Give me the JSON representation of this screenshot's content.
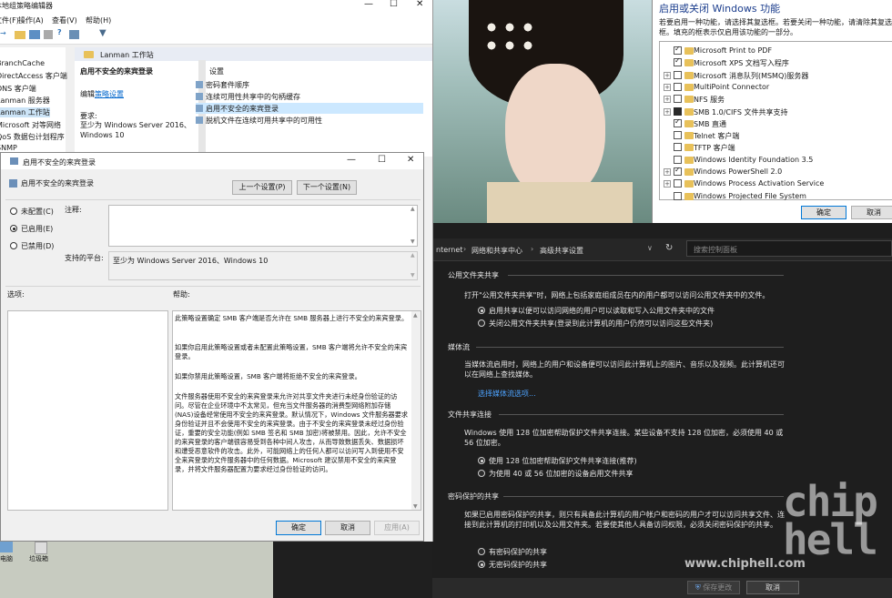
{
  "photo": {
    "alt": ""
  },
  "gpedit": {
    "title": "本地组策略编辑器",
    "menu": [
      "文件(F)",
      "操作(A)",
      "查看(V)",
      "帮助(H)"
    ],
    "tree": [
      "BranchCache",
      "DirectAccess 客户端",
      "DNS 客户端",
      "Lanman 服务器",
      "Lanman 工作站",
      "Microsoft 对等网络",
      "QoS 数据包计划程序",
      "SNMP"
    ],
    "tab_label": "Lanman 工作站",
    "policy_title": "启用不安全的来宾登录",
    "edit_prefix": "编辑",
    "edit_link": "策略设置",
    "req_label": "要求:",
    "req_text": "至少为 Windows Server 2016、Windows 10",
    "settings_header": "设置",
    "settings": [
      "密码套件顺序",
      "连续可用性共享中的句柄缓存",
      "启用不安全的来宾登录",
      "脱机文件在连续可用共享中的可用性"
    ],
    "taskbar_icons": [
      "电脑",
      "垃圾箱"
    ]
  },
  "dialog": {
    "title": "启用不安全的来宾登录",
    "policy_name": "启用不安全的来宾登录",
    "prev_button": "上一个设置(P)",
    "next_button": "下一个设置(N)",
    "radio_not_configured": "未配置(C)",
    "radio_enabled": "已启用(E)",
    "radio_disabled": "已禁用(D)",
    "comment_label": "注释:",
    "platform_label": "支持的平台:",
    "platform_text": "至少为 Windows Server 2016、Windows 10",
    "options_label": "选项:",
    "help_label": "帮助:",
    "help_p1": "此策略设置确定 SMB 客户端是否允许在 SMB 服务器上进行不安全的来宾登录。",
    "help_p2": "如果你启用此策略设置或者未配置此策略设置，SMB 客户端将允许不安全的来宾登录。",
    "help_p3": "如果你禁用此策略设置，SMB 客户端将拒绝不安全的来宾登录。",
    "help_p4": "文件服务器使用不安全的来宾登录来允许对共享文件夹进行未经身份验证的访问。尽管在企业环境中不太常见，但充当文件服务器的消费型网络附加存储(NAS)设备经常使用不安全的来宾登录。默认情况下，Windows 文件服务器要求身份验证并且不会使用不安全的来宾登录。由于不安全的来宾登录未经过身份验证，重要的安全功能(例如 SMB 签名和 SMB 加密)将被禁用。因此，允许不安全的来宾登录的客户端很容易受到各种中间人攻击，从而导致数据丢失、数据损坏和遭受恶意软件的攻击。此外，可能网络上的任何人都可以访问写入到使用不安全来宾登录的文件服务器中的任何数据。Microsoft 建议禁用不安全的来宾登录，并将文件服务器配置为要求经过身份验证的访问。",
    "ok": "确定",
    "cancel": "取消",
    "apply": "应用(A)"
  },
  "features": {
    "title": "启用或关闭 Windows 功能",
    "desc": "若要启用一种功能，请选择其复选框。若要关闭一种功能，请清除其复选框。填充的框表示仅启用该功能的一部分。",
    "items": [
      {
        "label": "Microsoft Print to PDF",
        "state": "checked",
        "expand": false
      },
      {
        "label": "Microsoft XPS 文档写入程序",
        "state": "checked",
        "expand": false
      },
      {
        "label": "Microsoft 消息队列(MSMQ)服务器",
        "state": "empty",
        "expand": true
      },
      {
        "label": "MultiPoint Connector",
        "state": "empty",
        "expand": true
      },
      {
        "label": "NFS 服务",
        "state": "empty",
        "expand": true
      },
      {
        "label": "SMB 1.0/CIFS 文件共享支持",
        "state": "filled",
        "expand": true
      },
      {
        "label": "SMB 直通",
        "state": "checked",
        "expand": false
      },
      {
        "label": "Telnet 客户端",
        "state": "empty",
        "expand": false
      },
      {
        "label": "TFTP 客户端",
        "state": "empty",
        "expand": false
      },
      {
        "label": "Windows Identity Foundation 3.5",
        "state": "empty",
        "expand": false
      },
      {
        "label": "Windows PowerShell 2.0",
        "state": "checked",
        "expand": true
      },
      {
        "label": "Windows Process Activation Service",
        "state": "empty",
        "expand": true
      },
      {
        "label": "Windows Projected File System",
        "state": "empty",
        "expand": false
      }
    ],
    "ok": "确定",
    "cancel": "取消"
  },
  "sharing": {
    "breadcrumb": [
      "nternet",
      "网络和共享中心",
      "高级共享设置"
    ],
    "search_placeholder": "搜索控制面板",
    "public_heading": "公用文件夹共享",
    "public_desc": "打开\"公用文件夹共享\"时，网络上包括家庭组成员在内的用户都可以访问公用文件夹中的文件。",
    "public_opt1": "启用共享以便可以访问网络的用户可以读取和写入公用文件夹中的文件",
    "public_opt2": "关闭公用文件夹共享(登录到此计算机的用户仍然可以访问这些文件夹)",
    "media_heading": "媒体流",
    "media_desc": "当媒体流启用时，网络上的用户和设备便可以访问此计算机上的图片、音乐以及视频。此计算机还可以在网络上查找媒体。",
    "media_link": "选择媒体流选项...",
    "conn_heading": "文件共享连接",
    "conn_desc": "Windows 使用 128 位加密帮助保护文件共享连接。某些设备不支持 128 位加密，必须使用 40 或 56 位加密。",
    "conn_opt1": "使用 128 位加密帮助保护文件共享连接(推荐)",
    "conn_opt2": "为使用 40 或 56 位加密的设备启用文件共享",
    "pw_heading": "密码保护的共享",
    "pw_desc": "如果已启用密码保护的共享，则只有具备此计算机的用户帐户和密码的用户才可以访问共享文件、连接到此计算机的打印机以及公用文件夹。若要使其他人具备访问权限，必须关闭密码保护的共享。",
    "pw_opt1": "有密码保护的共享",
    "pw_opt2": "无密码保护的共享",
    "save": "保存更改",
    "cancel": "取消"
  },
  "watermark": {
    "url": "www.chiphell.com",
    "logo": "chip hell"
  }
}
